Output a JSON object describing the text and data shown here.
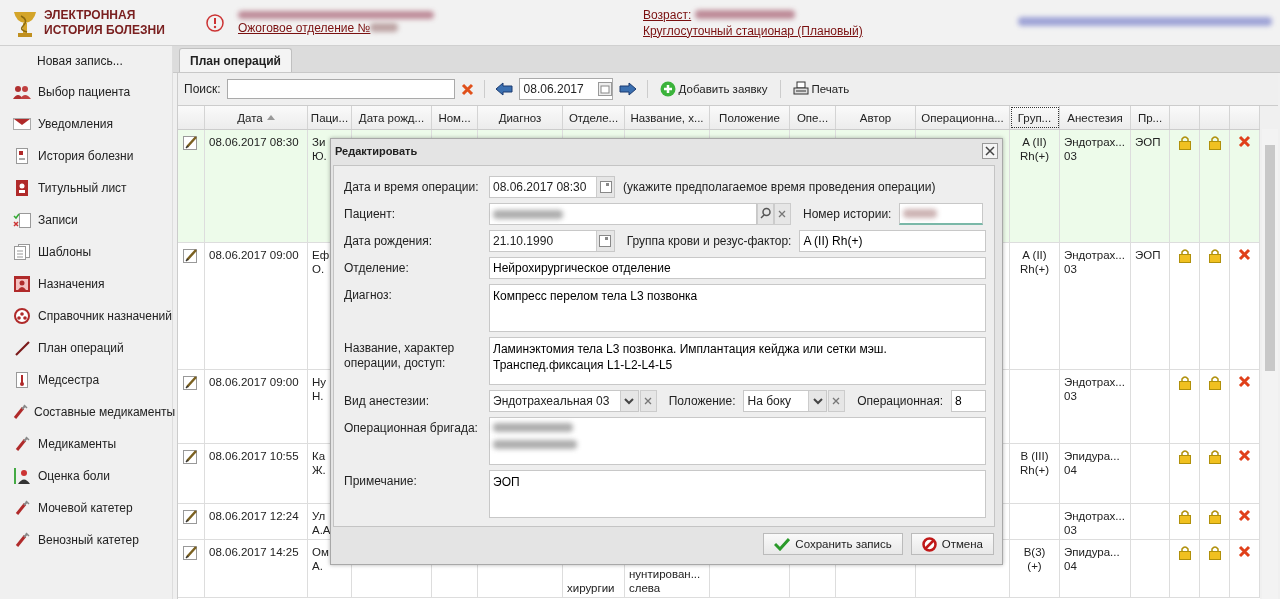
{
  "header": {
    "app_title": "ЭЛЕКТРОННАЯ ИСТОРИЯ БОЛЕЗНИ",
    "patient_link": {
      "redacted": true
    },
    "department_link": {
      "text": "Ожоговое отделение №",
      "redacted": true
    },
    "age_link": {
      "text": "Возраст:",
      "redacted": true
    },
    "stay_link": "Круглосуточный стационар (Плановый)",
    "user_link": {
      "redacted": true
    }
  },
  "sidebar": {
    "new_record": "Новая запись...",
    "items": [
      "Выбор пациента",
      "Уведомления",
      "История болезни",
      "Титульный лист",
      "Записи",
      "Шаблоны",
      "Назначения",
      "Справочник назначений",
      "План операций",
      "Медсестра",
      "Составные медикаменты",
      "Медикаменты",
      "Оценка боли",
      "Мочевой катетер",
      "Венозный катетер"
    ]
  },
  "tabs": [
    {
      "label": "План операций",
      "selected": true
    }
  ],
  "toolbar": {
    "search_label": "Поиск:",
    "date": "08.06.2017",
    "add_button": "Добавить заявку",
    "print_button": "Печать"
  },
  "table": {
    "columns": [
      {
        "focused": false
      },
      {
        "label": "Дата",
        "sorted_ascending": true,
        "focused": false
      },
      {
        "label": "Паци...",
        "focused": false
      },
      {
        "label": "Дата рожд...",
        "focused": false
      },
      {
        "label": "Ном...",
        "focused": false
      },
      {
        "label": "Диагноз",
        "focused": false
      },
      {
        "label": "Отделе...",
        "focused": false
      },
      {
        "label": "Название, х...",
        "focused": false
      },
      {
        "label": "Положение",
        "focused": false
      },
      {
        "label": "Опе...",
        "focused": false
      },
      {
        "label": "Автор",
        "focused": false
      },
      {
        "label": "Операционна...",
        "focused": false
      },
      {
        "label": "Груп...",
        "focused": true
      },
      {
        "label": "Анестезия",
        "focused": false
      },
      {
        "label": "Пр...",
        "focused": false
      },
      {
        "focused": false
      },
      {
        "focused": false
      },
      {
        "focused": false
      }
    ],
    "rows": [
      {
        "selected": true,
        "date": "08.06.2017 08:30",
        "patient": "Зи\nЮ.",
        "blood_group": "A (II)\nRh(+)",
        "anesthesia": "Эндотрах...\n03",
        "note": "ЭОП"
      },
      {
        "selected": false,
        "date": "08.06.2017 09:00",
        "patient": "Еф\nО.",
        "blood_group": "A (II)\nRh(+)",
        "anesthesia": "Эндотрах...\n03",
        "note": "ЭОП"
      },
      {
        "selected": false,
        "date": "08.06.2017 09:00",
        "patient": "Ну\nН.",
        "anesthesia": "Эндотрах...\n03"
      },
      {
        "selected": false,
        "date": "08.06.2017 10:55",
        "patient": "Ка\nЖ.",
        "blood_group": "B (III)\nRh(+)",
        "anesthesia": "Эпидура...\n04"
      },
      {
        "selected": false,
        "date": "08.06.2017 12:24",
        "patient": "Ул\nА.А",
        "anesthesia": "Эндотрах...\n03"
      },
      {
        "selected": false,
        "date": "08.06.2017 14:25",
        "patient": "Ом\nА.",
        "department": "хирургии",
        "operation": "нунтирован...\nслева",
        "blood_group": "B(3)\n(+)",
        "anesthesia": "Эпидура...\n04"
      }
    ]
  },
  "dialog": {
    "title": "Редактировать",
    "datetime": {
      "label": "Дата и время операции:",
      "value": "08.06.2017 08:30",
      "hint": "(укажите предполагаемое время проведения операции)"
    },
    "patient": {
      "label": "Пациент:",
      "redacted": true
    },
    "history": {
      "label": "Номер истории:",
      "redacted": true
    },
    "birth": {
      "label": "Дата рождения:",
      "value": "21.10.1990"
    },
    "blood": {
      "label": "Группа крови и резус-фактор:",
      "value": "A (II) Rh(+)"
    },
    "department": {
      "label": "Отделение:",
      "value": "Нейрохирургическое отделение"
    },
    "diagnosis": {
      "label": "Диагноз:",
      "value": "Компресс перелом тела L3 позвонка"
    },
    "operation": {
      "label": "Название, характер операции, доступ:",
      "value": "Ламинэктомия тела L3 позвонка. Имплантация кейджа или сетки мэш.\nТранспед.фиксация L1-L2-L4-L5"
    },
    "anesthesia": {
      "label": "Вид анестезии:",
      "value": "Эндотрахеальная 03"
    },
    "position": {
      "label": "Положение:",
      "value": "На боку"
    },
    "room": {
      "label": "Операционная:",
      "value": "8"
    },
    "team": {
      "label": "Операционная бригада:",
      "redacted": true
    },
    "remark": {
      "label": "Примечание:",
      "value": "ЭОП"
    },
    "save_button": "Сохранить запись",
    "cancel_button": "Отмена"
  }
}
